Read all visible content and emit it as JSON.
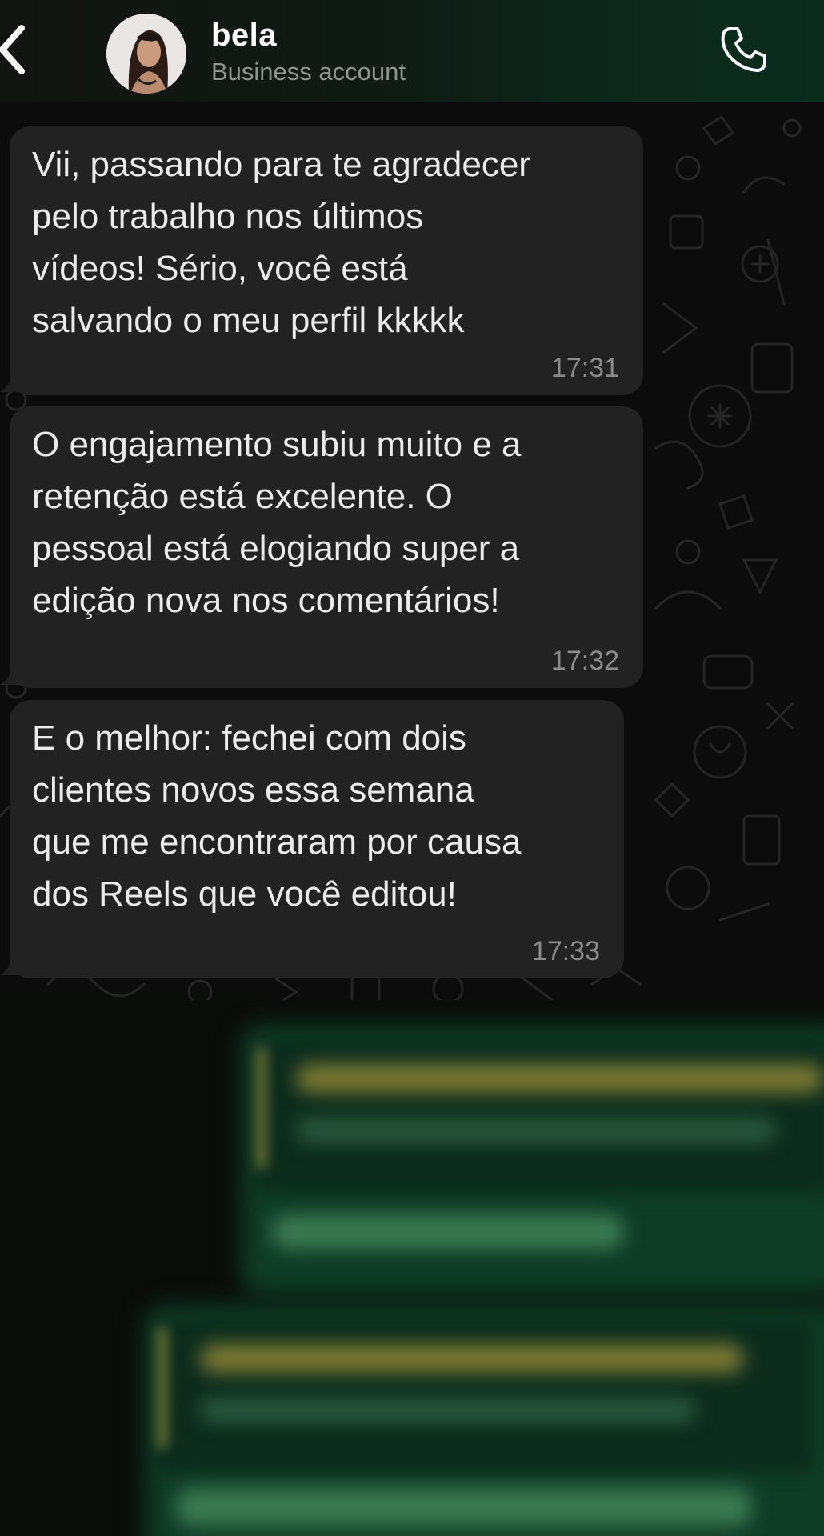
{
  "header": {
    "contact_name": "bela",
    "contact_subtitle": "Business account",
    "back_icon": "chevron-left-icon",
    "call_icon": "phone-icon"
  },
  "messages": [
    {
      "text": "Vii, passando para te agradecer\npelo trabalho nos últimos\nvídeos! Sério, você está\nsalvando o meu perfil kkkkk",
      "time": "17:31"
    },
    {
      "text": "O engajamento subiu muito e a\nretenção está excelente. O\npessoal está elogiando super a\nedição nova nos comentários!",
      "time": "17:32"
    },
    {
      "text": "E o melhor: fechei com dois\nclientes novos essa semana\nque me encontraram por causa\ndos Reels que você editou!",
      "time": "17:33"
    }
  ],
  "colors": {
    "incoming_bubble": "#222222",
    "outgoing_bubble_blurred": "#0f3c26",
    "header_accent": "#0a2d1e",
    "text": "#ebebeb",
    "timestamp": "#8a8a8a"
  }
}
